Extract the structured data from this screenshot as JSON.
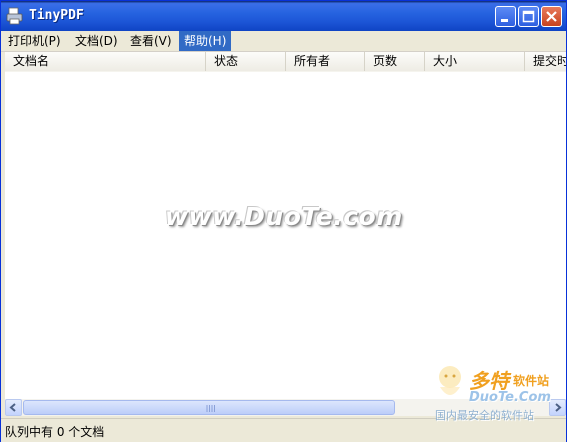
{
  "window": {
    "title": "TinyPDF"
  },
  "menu": [
    {
      "label": "打印机(P)"
    },
    {
      "label": "文档(D)"
    },
    {
      "label": "查看(V)"
    },
    {
      "label": "帮助(H)"
    }
  ],
  "columns": [
    {
      "label": "文档名"
    },
    {
      "label": "状态"
    },
    {
      "label": "所有者"
    },
    {
      "label": "页数"
    },
    {
      "label": "大小"
    },
    {
      "label": "提交时"
    }
  ],
  "watermark": "www.DuoTe.com",
  "status": {
    "text": "队列中有 0 个文档"
  },
  "logo": {
    "main": "多特",
    "suffix": "软件站",
    "domain": "DuoTe.Com",
    "tagline": "国内最安全的软件站"
  }
}
